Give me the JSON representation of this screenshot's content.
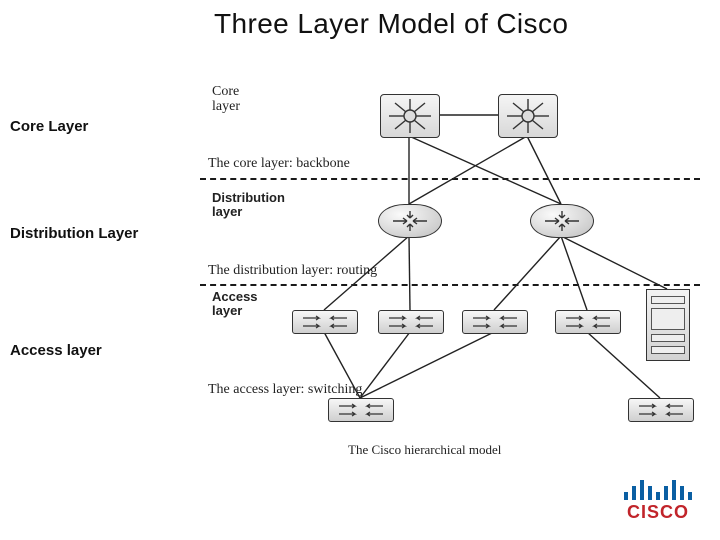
{
  "title": "Three Layer Model of Cisco",
  "sidebar": {
    "core": "Core Layer",
    "dist": "Distribution Layer",
    "acc": "Access layer"
  },
  "tags": {
    "core": "Core\nlayer",
    "dist": "Distribution\nlayer",
    "acc": "Access\nlayer"
  },
  "captions": {
    "core": "The core layer: backbone",
    "dist": "The distribution layer: routing",
    "acc": "The access layer: switching"
  },
  "figure_caption": "The Cisco hierarchical model",
  "logo": {
    "name": "cisco",
    "text": "CISCO"
  }
}
